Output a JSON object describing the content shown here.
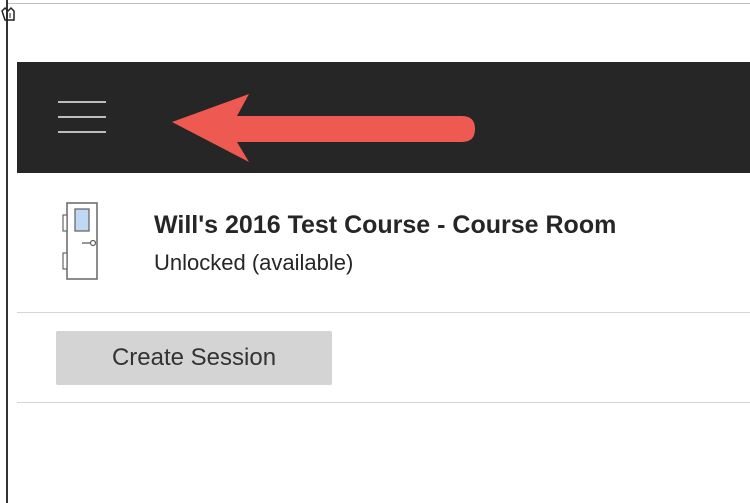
{
  "topbar": {
    "menu_icon": "hamburger-menu-icon",
    "annotation_icon": "red-arrow-annotation-icon",
    "background": "#262626"
  },
  "course": {
    "icon": "door-icon",
    "title": "Will's 2016 Test Course - Course Room",
    "status": "Unlocked (available)"
  },
  "actions": {
    "create_session_label": "Create Session"
  },
  "colors": {
    "annotation_arrow": "#ee5a52",
    "button_background": "#d4d4d4",
    "text": "#262626"
  }
}
